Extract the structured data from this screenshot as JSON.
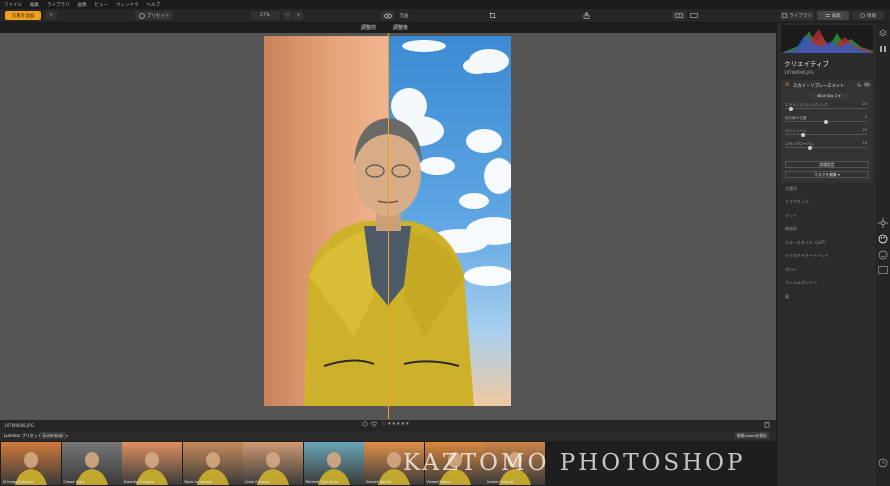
{
  "menu": [
    "ファイル",
    "編集",
    "ライブラリ",
    "画像",
    "ビュー",
    "ウィンドウ",
    "ヘルプ"
  ],
  "toolbar": {
    "import_label": "写真を追加",
    "add_symbol": "+",
    "presets_label": "プリセット",
    "zoom": "27%",
    "minus": "−",
    "plus": "+",
    "original_label": "元画",
    "library_label": "ライブラリ",
    "edit_label": "編集",
    "info_label": "情報"
  },
  "compare": {
    "before": "調整前",
    "after": "調整後"
  },
  "panel": {
    "title": "クリエイティブ",
    "filename": "1XTW0006.JPG",
    "tool": {
      "badge": "AI",
      "name": "スカイ・リプレースメント",
      "sky_select": "Blue Sky 2 ▾",
      "sliders": [
        {
          "label": "ホライゾンブレンディング",
          "value": "20",
          "pos": 0.05
        },
        {
          "label": "地平線の位置",
          "value": "0",
          "pos": 0.5
        },
        {
          "label": "ライトトーン",
          "value": "20",
          "pos": 0.2
        },
        {
          "label": "スカイグローバル",
          "value": "50",
          "pos": 0.3
        }
      ],
      "advanced_btn": "詳細設定",
      "mask_btn": "マスクを編集 ▾"
    },
    "tools": [
      "太陽光",
      "ドラマチック",
      "マット",
      "神秘的",
      "カラースタイル（LUT）",
      "テクスチャオーバーレイ",
      "グロー",
      "フィルムグレイン",
      "霧"
    ]
  },
  "bottom": {
    "filename": "1XTW0006.JPG",
    "stars": "☆ ★★★★★",
    "presets_title": "Luminar プリセット",
    "category": "Essentials",
    "save_btn": "新規Looksを保存"
  },
  "thumbs": [
    {
      "label": "AI Image Enhancer",
      "tint": "#d07a3a"
    },
    {
      "label": "Classic Black",
      "tint": "#777"
    },
    {
      "label": "Essential Enhance",
      "tint": "#e09060"
    },
    {
      "label": "Black Landscape",
      "tint": "#c68a5a"
    },
    {
      "label": "Quick Enhance",
      "tint": "#d09a72"
    },
    {
      "label": "Polished Cyan Nude",
      "tint": "#6aa7b8"
    },
    {
      "label": "Smooth Details",
      "tint": "#e0904a"
    },
    {
      "label": "Vibrant Nature",
      "tint": "#d8883c"
    },
    {
      "label": "Instant Contrast",
      "tint": "#cc8448"
    }
  ],
  "watermark": "KAZTOMO PHOTOSHOP",
  "colors": {
    "accent": "#f2a01b",
    "panel": "#2b2b2b",
    "canvas": "#555555"
  }
}
